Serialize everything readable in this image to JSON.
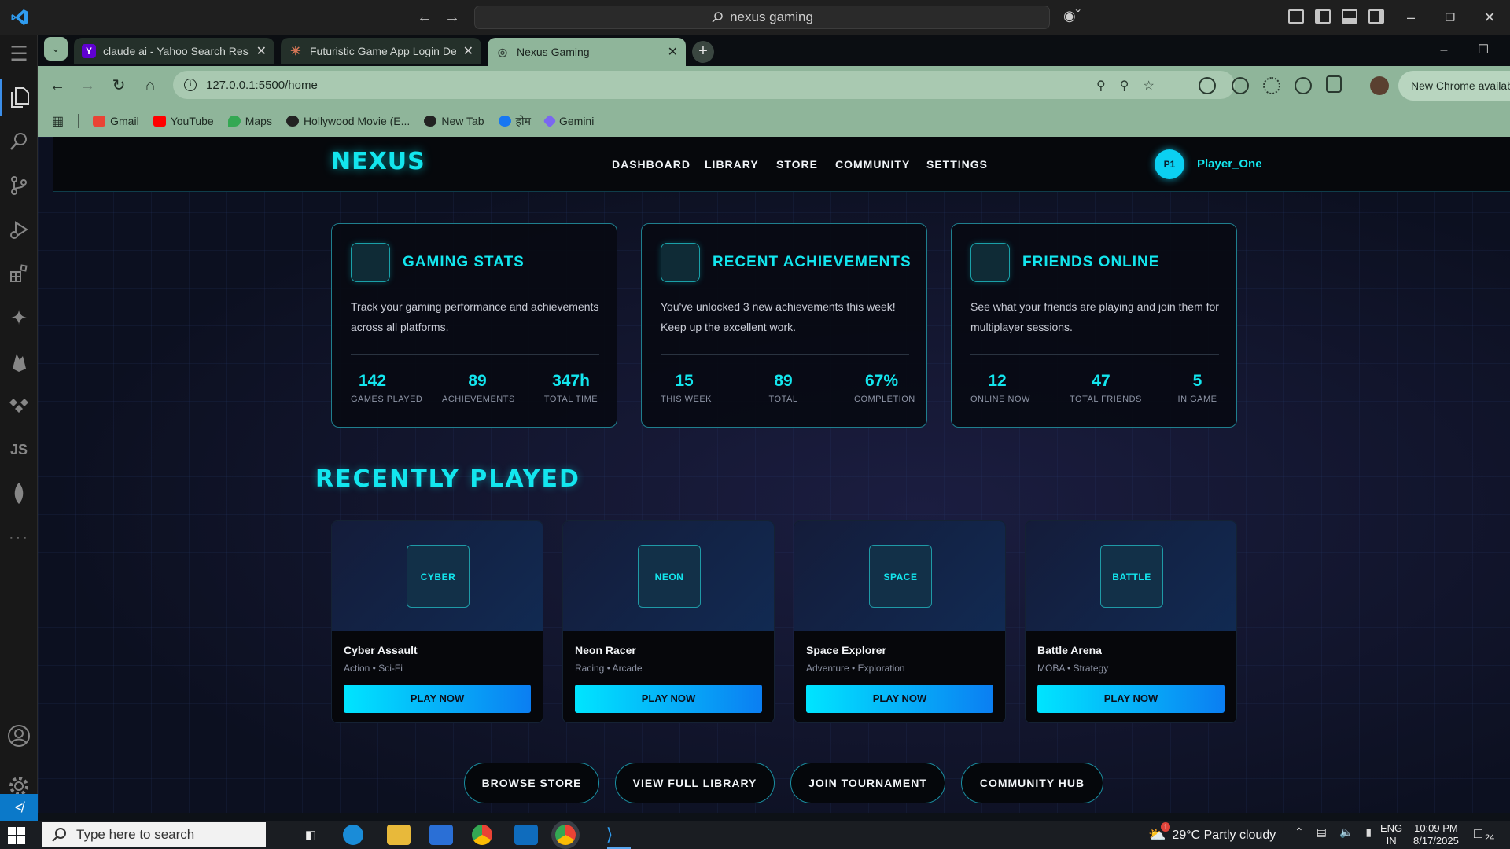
{
  "vscode": {
    "command_center": "nexus gaming",
    "activity_items": [
      "explorer-icon",
      "search-icon",
      "source-control-icon",
      "run-debug-icon",
      "extensions-icon",
      "copilot-icon",
      "firebase-icon",
      "remote-explorer-icon",
      "js-icon",
      "mongodb-icon",
      "more-icon"
    ],
    "js_label": "JS"
  },
  "chrome": {
    "tabs": [
      {
        "title": "claude ai - Yahoo Search Results",
        "favicon": "Y",
        "color": "#6001d2"
      },
      {
        "title": "Futuristic Game App Login Design",
        "favicon": "✳",
        "color": "#d97757"
      },
      {
        "title": "Nexus Gaming",
        "favicon": "◎",
        "color": "#5f6b65"
      }
    ],
    "address": "127.0.0.1:5500/home",
    "new_chrome_banner": "New Chrome available",
    "bookmarks": [
      {
        "label": "Gmail",
        "color": "#ea4335"
      },
      {
        "label": "YouTube",
        "color": "#ff0000"
      },
      {
        "label": "Maps",
        "color": "#34a853"
      },
      {
        "label": "Hollywood Movie (E...",
        "color": "#222222"
      },
      {
        "label": "New Tab",
        "color": "#222222"
      },
      {
        "label": "होम",
        "color": "#1877f2"
      },
      {
        "label": "Gemini",
        "color": "#7a67f0"
      }
    ]
  },
  "site": {
    "brand": "NEXUS",
    "nav": [
      "DASHBOARD",
      "LIBRARY",
      "STORE",
      "COMMUNITY",
      "SETTINGS"
    ],
    "user": {
      "initials": "P1",
      "name": "Player_One"
    },
    "cards": [
      {
        "title": "GAMING STATS",
        "desc": "Track your gaming performance and achievements across all platforms.",
        "stats": [
          {
            "num": "142",
            "label": "GAMES PLAYED"
          },
          {
            "num": "89",
            "label": "ACHIEVEMENTS"
          },
          {
            "num": "347h",
            "label": "TOTAL TIME"
          }
        ]
      },
      {
        "title": "RECENT ACHIEVEMENTS",
        "desc": "You've unlocked 3 new achievements this week! Keep up the excellent work.",
        "stats": [
          {
            "num": "15",
            "label": "THIS WEEK"
          },
          {
            "num": "89",
            "label": "TOTAL"
          },
          {
            "num": "67%",
            "label": "COMPLETION"
          }
        ]
      },
      {
        "title": "FRIENDS ONLINE",
        "desc": "See what your friends are playing and join them for multiplayer sessions.",
        "stats": [
          {
            "num": "12",
            "label": "ONLINE NOW"
          },
          {
            "num": "47",
            "label": "TOTAL FRIENDS"
          },
          {
            "num": "5",
            "label": "IN GAME"
          }
        ]
      }
    ],
    "recent_title": "RECENTLY PLAYED",
    "games": [
      {
        "tag": "CYBER",
        "name": "Cyber Assault",
        "genre": "Action • Sci-Fi",
        "button": "PLAY NOW"
      },
      {
        "tag": "NEON",
        "name": "Neon Racer",
        "genre": "Racing • Arcade",
        "button": "PLAY NOW"
      },
      {
        "tag": "SPACE",
        "name": "Space Explorer",
        "genre": "Adventure • Exploration",
        "button": "PLAY NOW"
      },
      {
        "tag": "BATTLE",
        "name": "Battle Arena",
        "genre": "MOBA • Strategy",
        "button": "PLAY NOW"
      }
    ],
    "actions": [
      "BROWSE STORE",
      "VIEW FULL LIBRARY",
      "JOIN TOURNAMENT",
      "COMMUNITY HUB"
    ],
    "accent": "#13e6ee"
  },
  "taskbar": {
    "search_placeholder": "Type here to search",
    "weather": "29°C  Partly cloudy",
    "weather_badge": "1",
    "lang": [
      "ENG",
      "IN"
    ],
    "time": "10:09 PM",
    "date": "8/17/2025",
    "notifications": "24"
  }
}
